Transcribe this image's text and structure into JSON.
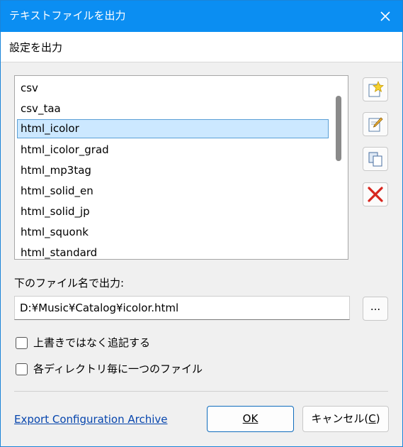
{
  "window": {
    "title": "テキストファイルを出力"
  },
  "header": {
    "title": "設定を出力"
  },
  "list": {
    "items": [
      "csv",
      "csv_taa",
      "html_icolor",
      "html_icolor_grad",
      "html_mp3tag",
      "html_solid_en",
      "html_solid_jp",
      "html_squonk",
      "html_standard"
    ],
    "selected_index": 2
  },
  "side_buttons": [
    {
      "icon": "new-star-icon"
    },
    {
      "icon": "edit-pencil-icon"
    },
    {
      "icon": "duplicate-icon"
    },
    {
      "icon": "delete-x-icon"
    }
  ],
  "output": {
    "label": "下のファイル名で出力:",
    "path": "D:¥Music¥Catalog¥icolor.html",
    "browse_label": "..."
  },
  "options": {
    "append_label": "上書きではなく追記する",
    "append_checked": false,
    "per_directory_label": "各ディレクトリ毎に一つのファイル",
    "per_directory_checked": false
  },
  "footer": {
    "link_label": "Export Configuration Archive",
    "ok_label": "OK",
    "cancel_label": "キャンセル(",
    "cancel_hotkey": "C",
    "cancel_suffix": ")"
  },
  "colors": {
    "titlebar": "#0b8ef2",
    "selection": "#cce8ff",
    "link": "#0645ad"
  }
}
